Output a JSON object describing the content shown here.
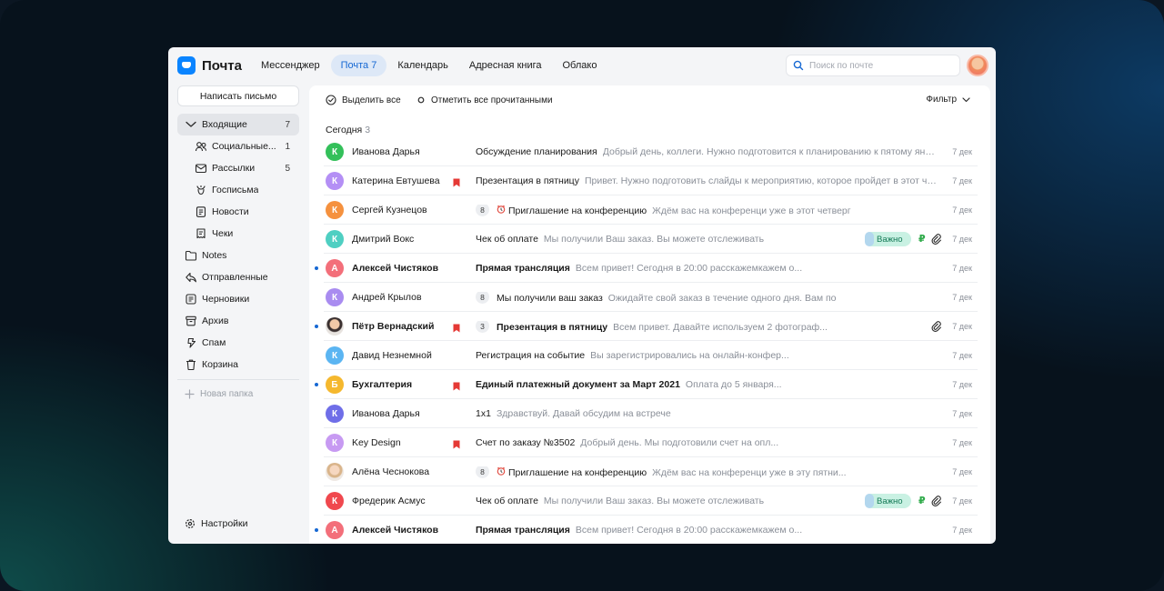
{
  "header": {
    "logo_text": "Почта",
    "tabs": [
      {
        "label": "Мессенджер",
        "active": false
      },
      {
        "label": "Почта 7",
        "active": true
      },
      {
        "label": "Календарь",
        "active": false
      },
      {
        "label": "Адресная книга",
        "active": false
      },
      {
        "label": "Облако",
        "active": false
      }
    ],
    "search_placeholder": "Поиск по почте"
  },
  "sidebar": {
    "compose_label": "Написать письмо",
    "folders": [
      {
        "label": "Входящие",
        "count": "7",
        "icon": "chevron-down-icon",
        "active": true,
        "sub": false
      },
      {
        "label": "Социальные...",
        "count": "1",
        "icon": "people-icon",
        "active": false,
        "sub": true
      },
      {
        "label": "Рассылки",
        "count": "5",
        "icon": "newsletter-icon",
        "active": false,
        "sub": true
      },
      {
        "label": "Госписьма",
        "count": "",
        "icon": "emblem-icon",
        "active": false,
        "sub": true
      },
      {
        "label": "Новости",
        "count": "",
        "icon": "news-icon",
        "active": false,
        "sub": true
      },
      {
        "label": "Чеки",
        "count": "",
        "icon": "receipt-icon",
        "active": false,
        "sub": true
      },
      {
        "label": "Notes",
        "count": "",
        "icon": "folder-icon",
        "active": false,
        "sub": false
      },
      {
        "label": "Отправленные",
        "count": "",
        "icon": "sent-icon",
        "active": false,
        "sub": false
      },
      {
        "label": "Черновики",
        "count": "",
        "icon": "draft-icon",
        "active": false,
        "sub": false
      },
      {
        "label": "Архив",
        "count": "",
        "icon": "archive-icon",
        "active": false,
        "sub": false
      },
      {
        "label": "Спам",
        "count": "",
        "icon": "spam-icon",
        "active": false,
        "sub": false
      },
      {
        "label": "Корзина",
        "count": "",
        "icon": "trash-icon",
        "active": false,
        "sub": false
      }
    ],
    "new_folder_label": "Новая папка",
    "settings_label": "Настройки"
  },
  "toolbar": {
    "select_all_label": "Выделить все",
    "mark_read_label": "Отметить все прочитанными",
    "filter_label": "Фильтр"
  },
  "group": {
    "label": "Сегодня",
    "count": "3"
  },
  "colors": {
    "accent": "#1668d3",
    "tag_bg": "#c9f1e3",
    "flag": "#e53935"
  },
  "messages": [
    {
      "avatar_letter": "К",
      "avatar_color": "#33c05a",
      "sender": "Иванова Дарья",
      "unread": false,
      "flag": false,
      "thread": "",
      "clock": false,
      "subject": "Обсуждение планирования",
      "snippet": "Добрый день, коллеги. Нужно подготовится к планированию к пятому января...",
      "tag": "",
      "ruble": false,
      "clip": false,
      "date": "7 дек"
    },
    {
      "avatar_letter": "К",
      "avatar_color": "#b48ff5",
      "sender": "Катерина Евтушева",
      "unread": false,
      "flag": true,
      "thread": "",
      "clock": false,
      "subject": "Презентация в пятницу",
      "snippet": "Привет. Нужно подготовить слайды к мероприятию, которое пройдет в этот четве...",
      "tag": "",
      "ruble": false,
      "clip": false,
      "date": "7 дек"
    },
    {
      "avatar_letter": "К",
      "avatar_color": "#f5913e",
      "sender": "Сергей Кузнецов",
      "unread": false,
      "flag": false,
      "thread": "8",
      "clock": true,
      "subject": "Приглашение на конференцию",
      "snippet": "Ждём вас на конференци уже в этот четверг",
      "tag": "",
      "ruble": false,
      "clip": false,
      "date": "7 дек"
    },
    {
      "avatar_letter": "К",
      "avatar_color": "#4fcfc2",
      "sender": "Дмитрий Вокс",
      "unread": false,
      "flag": false,
      "thread": "",
      "clock": false,
      "subject": "Чек об оплате",
      "snippet": "Мы получили Ваш заказ. Вы можете отслеживать",
      "tag": "Важно",
      "ruble": true,
      "clip": true,
      "date": "7 дек"
    },
    {
      "avatar_letter": "А",
      "avatar_color": "#f36f7a",
      "sender": "Алексей Чистяков",
      "unread": true,
      "flag": false,
      "thread": "",
      "clock": false,
      "subject": "Прямая трансляция",
      "snippet": "Всем привет! Сегодня в 20:00 расскажемкажем о...",
      "tag": "",
      "ruble": false,
      "clip": false,
      "date": "7 дек"
    },
    {
      "avatar_letter": "К",
      "avatar_color": "#a98cf0",
      "sender": "Андрей Крылов",
      "unread": false,
      "flag": false,
      "thread": "8",
      "clock": false,
      "subject": "Мы получили ваш заказ",
      "snippet": "Ожидайте свой заказ в течение одного дня. Вам по",
      "tag": "",
      "ruble": false,
      "clip": false,
      "date": "7 дек"
    },
    {
      "avatar_letter": "",
      "avatar_color": "photo1",
      "sender": "Пётр Вернадский",
      "unread": true,
      "flag": true,
      "thread": "3",
      "clock": false,
      "subject": "Презентация в пятницу",
      "snippet": "Всем привет. Давайте используем 2 фотограф...",
      "tag": "",
      "ruble": false,
      "clip": true,
      "date": "7 дек"
    },
    {
      "avatar_letter": "К",
      "avatar_color": "#5bb5f2",
      "sender": "Давид Незнемной",
      "unread": false,
      "flag": false,
      "thread": "",
      "clock": false,
      "subject": "Регистрация на событие",
      "snippet": "Вы зарегистрировались на онлайн-конфер...",
      "tag": "",
      "ruble": false,
      "clip": false,
      "date": "7 дек"
    },
    {
      "avatar_letter": "Б",
      "avatar_color": "#f5b82e",
      "sender": "Бухгалтерия",
      "unread": true,
      "flag": true,
      "thread": "",
      "clock": false,
      "subject": "Единый платежный документ за Март 2021",
      "snippet": "Оплата до 5 января...",
      "tag": "",
      "ruble": false,
      "clip": false,
      "date": "7 дек"
    },
    {
      "avatar_letter": "К",
      "avatar_color": "#6f6ee8",
      "sender": "Иванова Дарья",
      "unread": false,
      "flag": false,
      "thread": "",
      "clock": false,
      "subject": "1х1",
      "snippet": "Здравствуй. Давай обсудим на встрече",
      "tag": "",
      "ruble": false,
      "clip": false,
      "date": "7 дек"
    },
    {
      "avatar_letter": "К",
      "avatar_color": "#c79af2",
      "sender": "Key Design",
      "unread": false,
      "flag": true,
      "thread": "",
      "clock": false,
      "subject": "Счет по заказу №3502",
      "snippet": "Добрый день. Мы подготовили счет на опл...",
      "tag": "",
      "ruble": false,
      "clip": false,
      "date": "7 дек"
    },
    {
      "avatar_letter": "",
      "avatar_color": "photo2",
      "sender": "Алёна Чеснокова",
      "unread": false,
      "flag": false,
      "thread": "8",
      "clock": true,
      "subject": "Приглашение на конференцию",
      "snippet": "Ждём вас на конференци уже в эту пятни...",
      "tag": "",
      "ruble": false,
      "clip": false,
      "date": "7 дек"
    },
    {
      "avatar_letter": "К",
      "avatar_color": "#f0484e",
      "sender": "Фредерик Асмус",
      "unread": false,
      "flag": false,
      "thread": "",
      "clock": false,
      "subject": "Чек об оплате",
      "snippet": "Мы получили Ваш заказ. Вы можете отслеживать",
      "tag": "Важно",
      "ruble": true,
      "clip": true,
      "date": "7 дек"
    },
    {
      "avatar_letter": "А",
      "avatar_color": "#f36f7a",
      "sender": "Алексей Чистяков",
      "unread": true,
      "flag": false,
      "thread": "",
      "clock": false,
      "subject": "Прямая трансляция",
      "snippet": "Всем привет! Сегодня в 20:00 расскажемкажем о...",
      "tag": "",
      "ruble": false,
      "clip": false,
      "date": "7 дек"
    }
  ]
}
